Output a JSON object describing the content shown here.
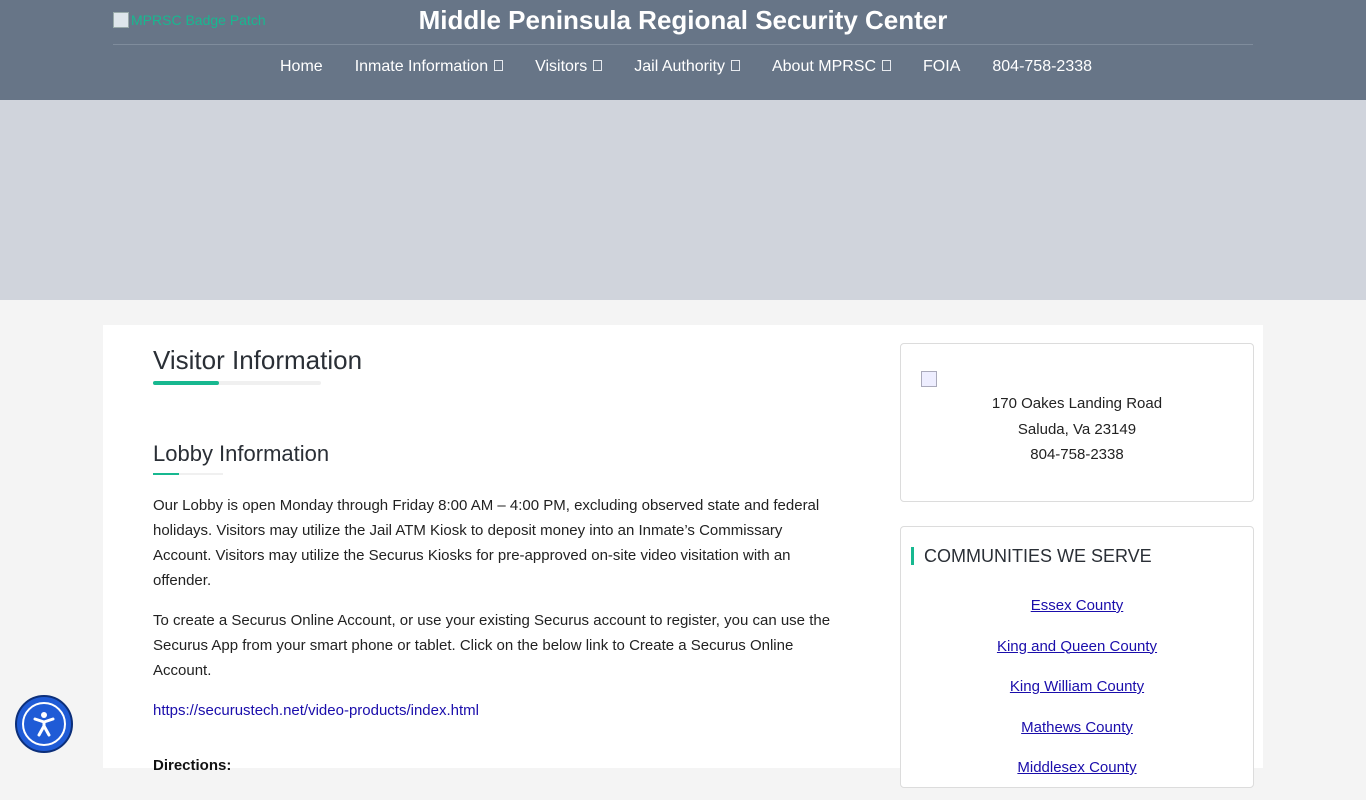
{
  "header": {
    "logo_alt": "MPRSC Badge Patch",
    "title": "Middle Peninsula Regional Security Center",
    "nav": [
      {
        "label": "Home",
        "has_dropdown": false
      },
      {
        "label": "Inmate Information",
        "has_dropdown": true
      },
      {
        "label": "Visitors",
        "has_dropdown": true
      },
      {
        "label": "Jail Authority",
        "has_dropdown": true
      },
      {
        "label": "About MPRSC",
        "has_dropdown": true
      },
      {
        "label": "FOIA",
        "has_dropdown": false
      },
      {
        "label": "804-758-2338",
        "has_dropdown": false
      }
    ]
  },
  "main": {
    "page_title": "Visitor Information",
    "section_title": "Lobby Information",
    "paragraph1": "Our Lobby is open Monday through Friday 8:00 AM – 4:00 PM, excluding observed state and federal holidays.  Visitors may utilize the Jail ATM Kiosk to deposit money into an Inmate’s Commissary Account.  Visitors may utilize the Securus Kiosks for pre-approved on-site video visitation with an offender.",
    "paragraph2": "To create a Securus Online Account, or use your existing Securus account to register, you can use the Securus App from your smart phone or tablet. Click on the below link to Create a Securus Online Account.",
    "securus_link": "https://securustech.net/video-products/index.html",
    "directions_label": "Directions:"
  },
  "sidebar": {
    "address": {
      "line1": "170 Oakes Landing Road",
      "line2": "Saluda, Va 23149",
      "phone": "804-758-2338"
    },
    "communities": {
      "title": "COMMUNITIES WE SERVE",
      "items": [
        "Essex County",
        "King and Queen County",
        "King William County",
        "Mathews County",
        "Middlesex County"
      ]
    }
  },
  "colors": {
    "header_bg": "#677587",
    "banner_bg": "#d0d4dc",
    "accent": "#17b890",
    "link": "#1a0dab",
    "a11y_button": "#1f5bd6"
  },
  "icons": {
    "dropdown": "dropdown-caret-icon",
    "accessibility": "accessibility-icon",
    "broken_image": "broken-image-icon"
  }
}
